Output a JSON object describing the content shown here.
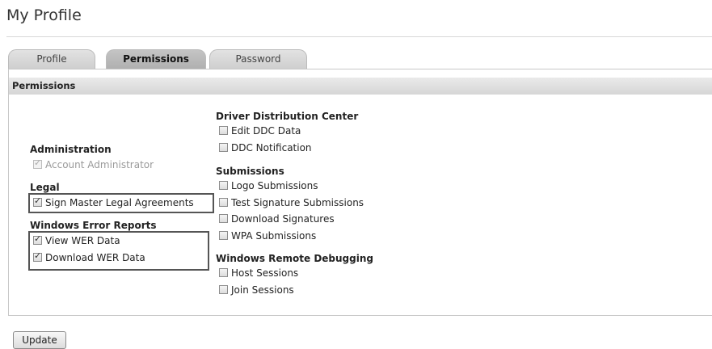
{
  "page": {
    "title": "My Profile"
  },
  "tabs": [
    {
      "label": "Profile",
      "active": false
    },
    {
      "label": "Permissions",
      "active": true
    },
    {
      "label": "Password",
      "active": false
    }
  ],
  "panel": {
    "header": "Permissions"
  },
  "left_column": {
    "administration": {
      "title": "Administration",
      "items": [
        {
          "label": "Account Administrator",
          "checked": true,
          "disabled": true
        }
      ]
    },
    "legal": {
      "title": "Legal",
      "items": [
        {
          "label": "Sign Master Legal Agreements",
          "checked": true,
          "disabled": false
        }
      ]
    },
    "wer": {
      "title": "Windows Error Reports",
      "items": [
        {
          "label": "View WER Data",
          "checked": true,
          "disabled": false
        },
        {
          "label": "Download WER Data",
          "checked": true,
          "disabled": false
        }
      ]
    }
  },
  "right_column": {
    "ddc": {
      "title": "Driver Distribution Center",
      "items": [
        {
          "label": "Edit DDC Data",
          "checked": false
        },
        {
          "label": "DDC Notification",
          "checked": false
        }
      ]
    },
    "submissions": {
      "title": "Submissions",
      "items": [
        {
          "label": "Logo Submissions",
          "checked": false
        },
        {
          "label": "Test Signature Submissions",
          "checked": false
        },
        {
          "label": "Download Signatures",
          "checked": false
        },
        {
          "label": "WPA Submissions",
          "checked": false
        }
      ]
    },
    "remote_debugging": {
      "title": "Windows Remote Debugging",
      "items": [
        {
          "label": "Host Sessions",
          "checked": false
        },
        {
          "label": "Join Sessions",
          "checked": false
        }
      ]
    }
  },
  "actions": {
    "update_label": "Update"
  },
  "icons": {
    "checkmark": "checkmark-icon"
  }
}
